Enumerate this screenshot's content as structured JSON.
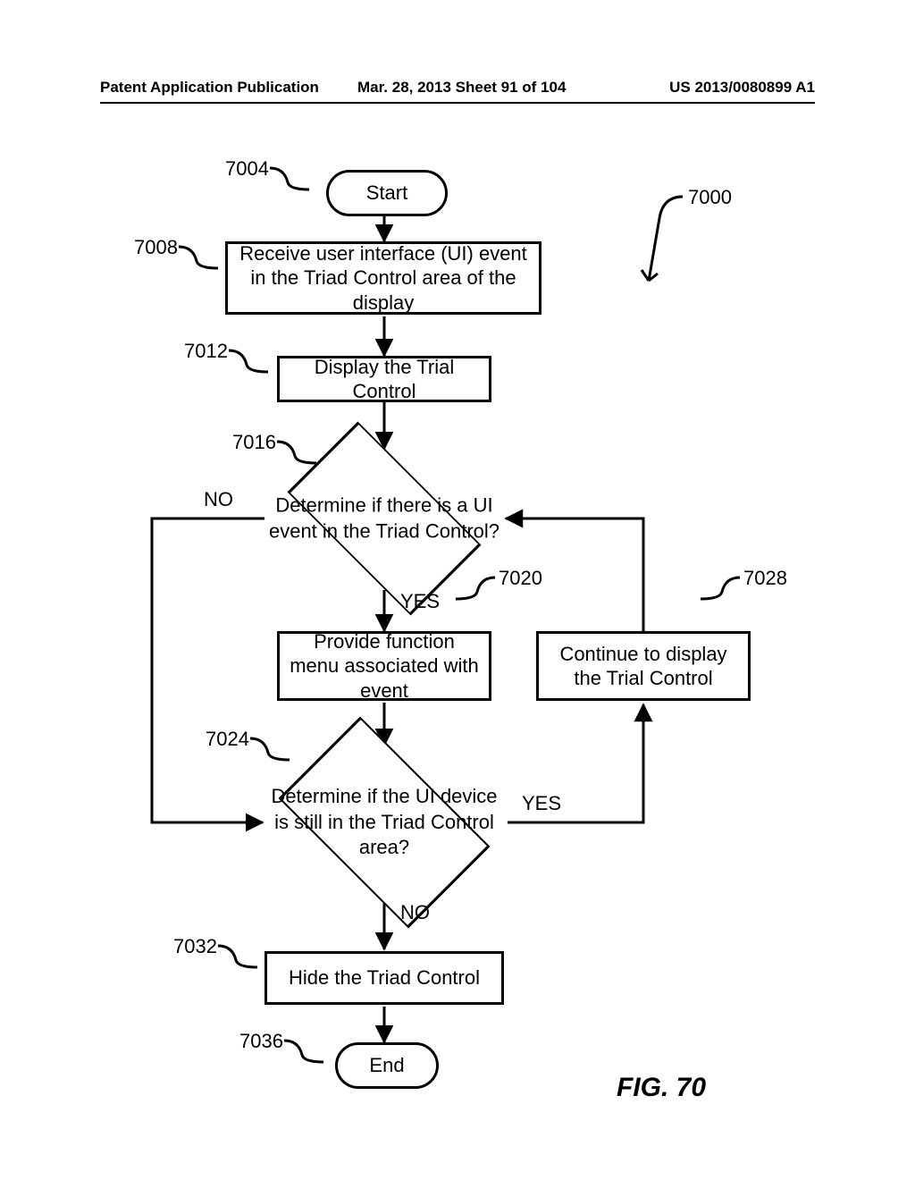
{
  "header": {
    "left": "Patent Application Publication",
    "mid": "Mar. 28, 2013  Sheet 91 of 104",
    "right": "US 2013/0080899 A1"
  },
  "figure": {
    "caption": "FIG. 70",
    "ref_overall": "7000",
    "nodes": {
      "start": {
        "ref": "7004",
        "text": "Start"
      },
      "receive": {
        "ref": "7008",
        "text": "Receive user interface (UI) event in the Triad Control area of the display"
      },
      "display": {
        "ref": "7012",
        "text": "Display the Trial Control"
      },
      "dec1": {
        "ref": "7016",
        "text": "Determine if there is a UI event in the Triad Control?",
        "no_label": "NO",
        "yes_label": "YES"
      },
      "provide": {
        "ref": "7020",
        "text": "Provide function menu associated with event"
      },
      "continue": {
        "ref": "7028",
        "text": "Continue to display the Trial Control"
      },
      "dec2": {
        "ref": "7024",
        "text": "Determine if the UI device is still in the Triad Control area?",
        "no_label": "NO",
        "yes_label": "YES"
      },
      "hide": {
        "ref": "7032",
        "text": "Hide the Triad Control"
      },
      "end": {
        "ref": "7036",
        "text": "End"
      }
    }
  }
}
